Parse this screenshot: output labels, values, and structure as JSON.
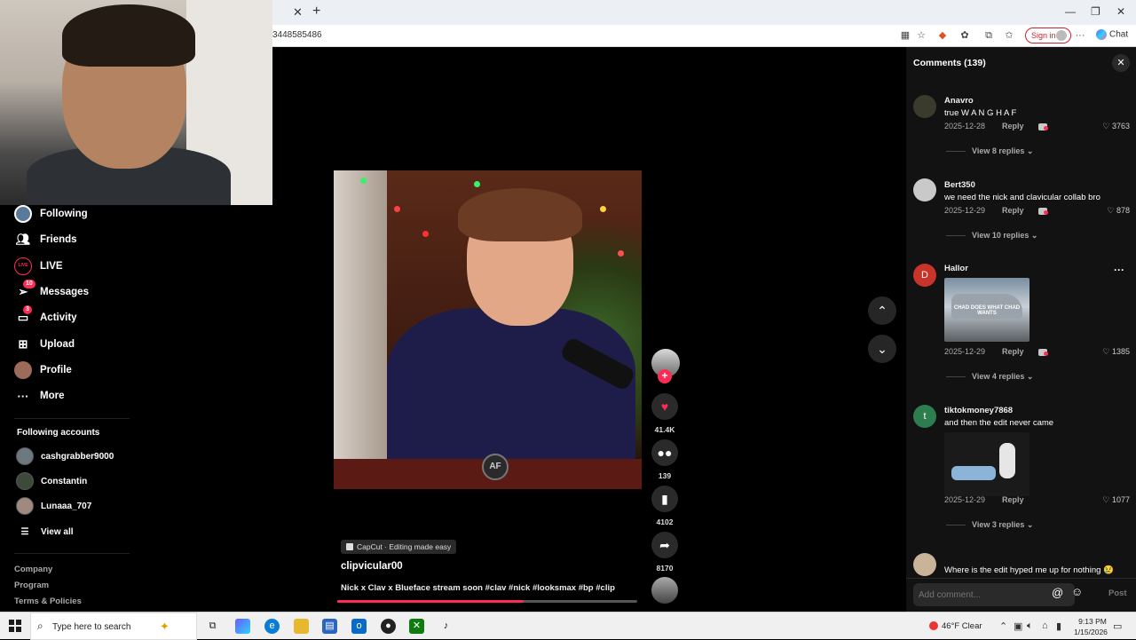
{
  "browser": {
    "url": "3448585486",
    "signin_label": "Sign in",
    "chat_label": "Chat",
    "close_tab_glyph": "✕",
    "new_tab_glyph": "+"
  },
  "sidebar": {
    "items": [
      {
        "label": "Following",
        "icon": "following-avatar-icon"
      },
      {
        "label": "Friends",
        "icon": "friends-icon"
      },
      {
        "label": "LIVE",
        "icon": "live-icon"
      },
      {
        "label": "Messages",
        "icon": "messages-icon",
        "badge": "10"
      },
      {
        "label": "Activity",
        "icon": "activity-icon",
        "badge": "3"
      },
      {
        "label": "Upload",
        "icon": "upload-icon"
      },
      {
        "label": "Profile",
        "icon": "profile-avatar-icon"
      },
      {
        "label": "More",
        "icon": "more-icon"
      }
    ],
    "following_accounts_title": "Following accounts",
    "accounts": [
      {
        "name": "cashgrabber9000"
      },
      {
        "name": "Constantin"
      },
      {
        "name": "Lunaaa_707"
      }
    ],
    "view_all": "View all",
    "footer_links": [
      "Company",
      "Program",
      "Terms & Policies"
    ]
  },
  "video": {
    "badge": "CapCut · Editing made easy",
    "author": "clipvicular00",
    "caption": "Nick x Clav x Blueface stream soon #clav #nick #looksmax #bp #clip",
    "progress": 0.62,
    "logo_text": "AF",
    "likes": "41.4K",
    "comments": "139",
    "saves": "4102",
    "shares": "8170"
  },
  "comments_panel": {
    "title": "Comments (139)",
    "comments": [
      {
        "user": "Anavro",
        "text": "true W A N G H A F",
        "date": "2025-12-28",
        "reply": "Reply",
        "likes": "3763",
        "replies": "View 8 replies"
      },
      {
        "user": "Bert350",
        "text": "we need the nick and clavicular collab bro",
        "date": "2025-12-29",
        "reply": "Reply",
        "likes": "878",
        "replies": "View 10 replies"
      },
      {
        "user": "Hallor",
        "avatar_letter": "D",
        "image_caption": "CHAD DOES WHAT CHAD WANTS",
        "date": "2025-12-29",
        "reply": "Reply",
        "likes": "1385",
        "replies": "View 4 replies"
      },
      {
        "user": "tiktokmoney7868",
        "avatar_letter": "t",
        "text": "and then the edit never came",
        "date": "2025-12-29",
        "reply": "Reply",
        "likes": "1077",
        "replies": "View 3 replies"
      },
      {
        "text": "Where is the edit hyped me up for nothing 😢"
      }
    ],
    "input_placeholder": "Add comment...",
    "post_label": "Post"
  },
  "taskbar": {
    "search_placeholder": "Type here to search",
    "weather": "46°F  Clear",
    "time": "9:13 PM",
    "date": "1/15/2026"
  }
}
